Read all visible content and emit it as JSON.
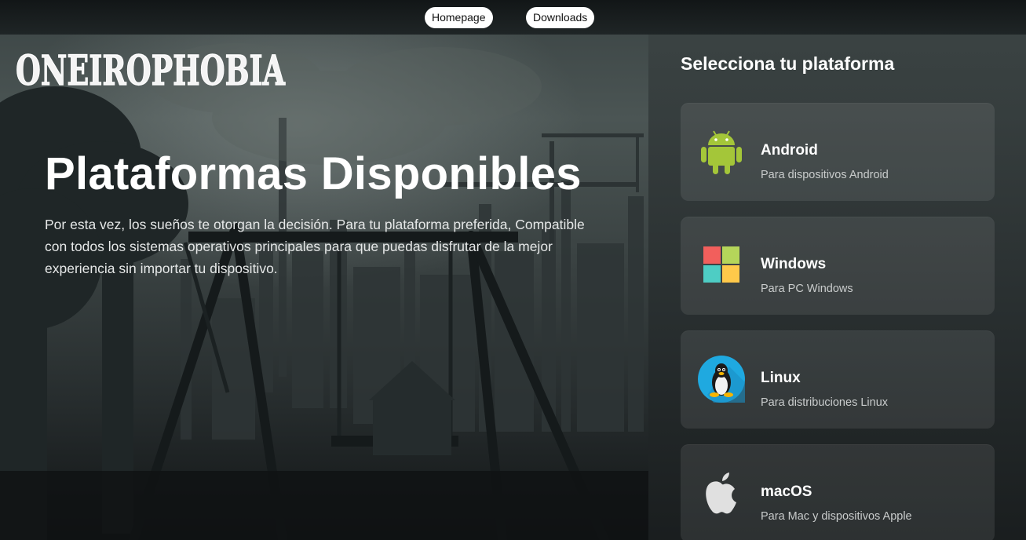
{
  "nav": {
    "homepage_label": "Homepage",
    "downloads_label": "Downloads"
  },
  "logo": {
    "text": "ONEIROPHOBIA"
  },
  "hero": {
    "title": "Plataformas Disponibles",
    "description": "Por esta vez, los sueños te otorgan la decisión. Para tu plataforma preferida, Compatible con todos los sistemas operativos principales para que puedas disfrutar de la mejor experiencia sin importar tu dispositivo."
  },
  "platforms": {
    "title": "Selecciona tu plataforma",
    "items": [
      {
        "name": "Android",
        "description": "Para dispositivos Android",
        "icon": "android-icon"
      },
      {
        "name": "Windows",
        "description": "Para PC Windows",
        "icon": "windows-icon"
      },
      {
        "name": "Linux",
        "description": "Para distribuciones Linux",
        "icon": "linux-tux-icon"
      },
      {
        "name": "macOS",
        "description": "Para Mac y dispositivos Apple",
        "icon": "apple-icon"
      }
    ]
  },
  "colors": {
    "android_green": "#a4c639",
    "windows_red": "#f25f5c",
    "windows_green": "#b5d55a",
    "windows_blue": "#4ecdc4",
    "windows_yellow": "#ffc94a",
    "linux_circle": "#1fa9e0",
    "apple_gray": "#e0e0e0"
  }
}
